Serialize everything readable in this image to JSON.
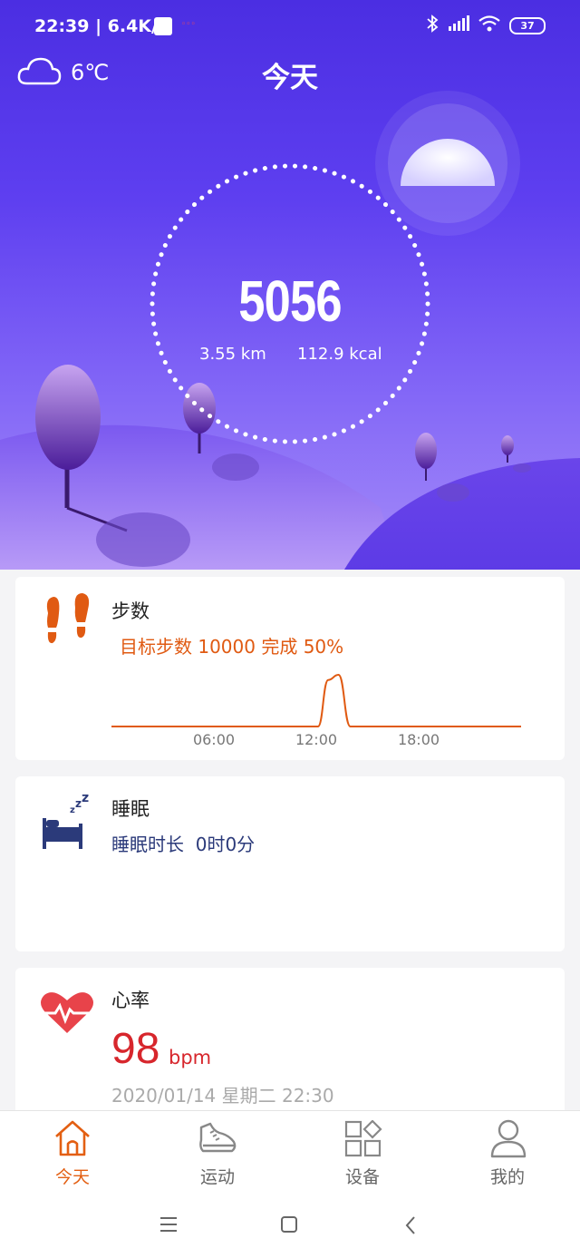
{
  "status_bar": {
    "time": "22:39 | 6.4K/s",
    "battery": "37"
  },
  "weather": {
    "temp": "6℃"
  },
  "header": {
    "title": "今天"
  },
  "today": {
    "steps": "5056",
    "distance": "3.55  km",
    "calories": "112.9  kcal"
  },
  "steps_card": {
    "title": "步数",
    "goal_text": "目标步数 10000 完成 50%",
    "chart_data": {
      "type": "line",
      "x_ticks": [
        "06:00",
        "12:00",
        "18:00"
      ],
      "x_range_hours": [
        0,
        24
      ],
      "series": [
        {
          "x": [
            0,
            12.1,
            12.7,
            13.3,
            14.0,
            24
          ],
          "y": [
            0,
            0,
            0.9,
            1.0,
            0,
            0
          ]
        }
      ],
      "color": "#e05a12"
    }
  },
  "sleep_card": {
    "title": "睡眠",
    "duration_text": "睡眠时长  0时0分"
  },
  "heart_card": {
    "title": "心率",
    "value": "98",
    "unit": "bpm",
    "datetime": "2020/01/14 星期二 22:30"
  },
  "nav": {
    "items": [
      {
        "label": "今天",
        "icon": "home-icon",
        "active": true
      },
      {
        "label": "运动",
        "icon": "shoe-icon",
        "active": false
      },
      {
        "label": "设备",
        "icon": "devices-icon",
        "active": false
      },
      {
        "label": "我的",
        "icon": "person-icon",
        "active": false
      }
    ]
  },
  "colors": {
    "accent": "#e35f12",
    "sleep": "#2b3a7a",
    "heart": "#e8434a",
    "hero": "#5e3ff0"
  }
}
